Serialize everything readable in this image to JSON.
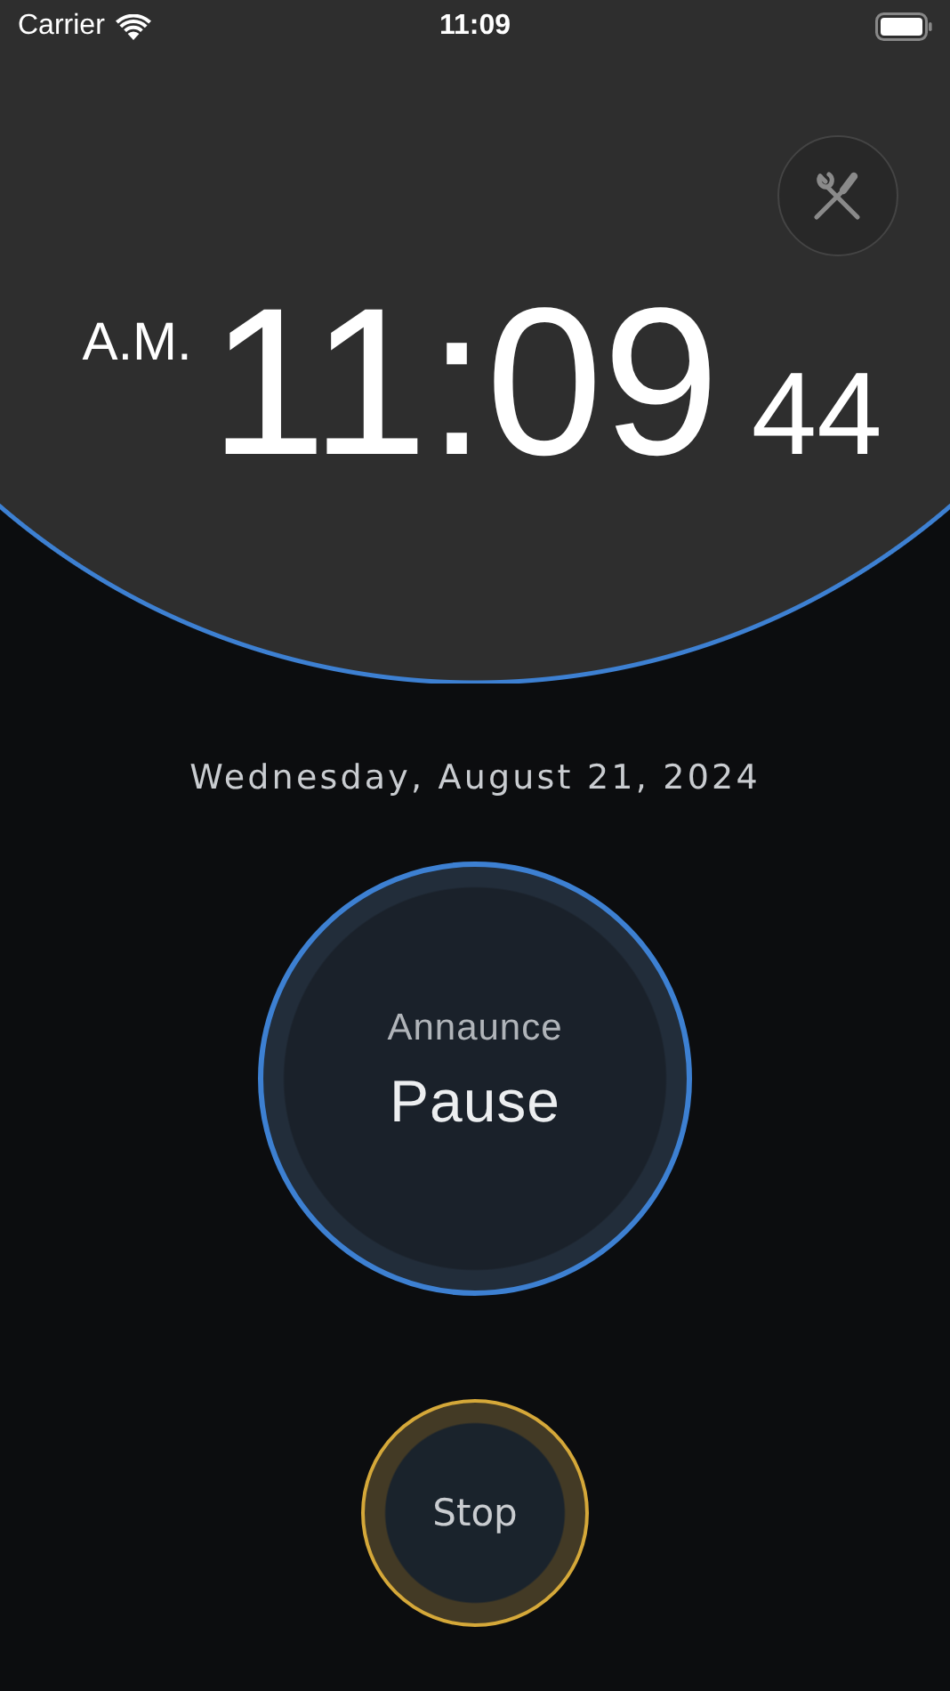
{
  "status_bar": {
    "carrier": "Carrier",
    "time": "11:09"
  },
  "clock": {
    "period": "A.M.",
    "time": "11:09",
    "seconds": "44"
  },
  "date": "Wednesday, August 21, 2024",
  "announce_button": {
    "caption": "Annaunce",
    "label": "Pause"
  },
  "stop_button": {
    "label": "Stop"
  }
}
